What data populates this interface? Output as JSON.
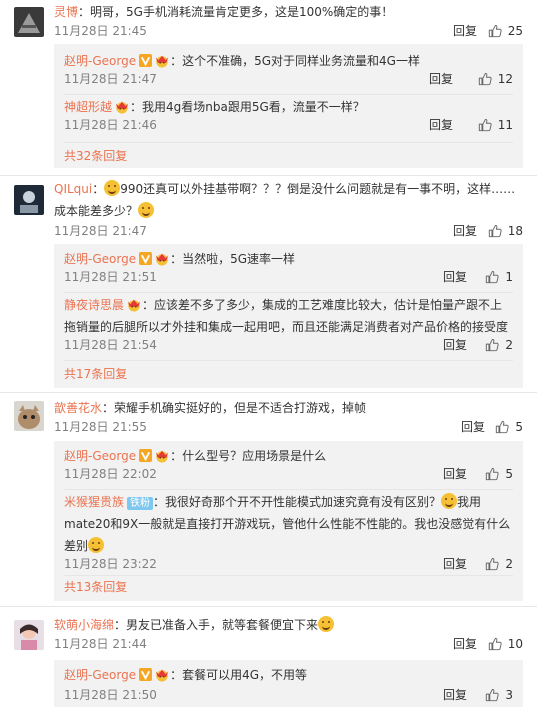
{
  "comments": [
    {
      "name": "灵博",
      "text": "：明哥，5G手机消耗流量肯定更多，这是100%确定的事！",
      "time": "11月28日 21:45",
      "reply_label": "回复",
      "likes": "25",
      "replies": [
        {
          "name": "赵明-George",
          "text": "：这个不准确，5G对于同样业务流量和4G一样",
          "time": "11月28日 21:47",
          "reply_label": "回复",
          "likes": "12"
        },
        {
          "name": "神超形越",
          "text": "：我用4g看场nba跟用5G看，流量不一样？",
          "time": "11月28日 21:46",
          "reply_label": "回复",
          "likes": "11"
        }
      ],
      "more": "共32条回复"
    },
    {
      "name": "QILqui",
      "text_a": "：",
      "text_b": "990还真可以外挂基带啊？？？倒是没什么问题就是有一事不明，这样……成本能差多少？",
      "time": "11月28日 21:47",
      "reply_label": "回复",
      "likes": "18",
      "replies": [
        {
          "name": "赵明-George",
          "text": "：当然啦，5G速率一样",
          "time": "11月28日 21:51",
          "reply_label": "回复",
          "likes": "1"
        },
        {
          "name": "静夜诗思晨",
          "text": "：应该差不多了多少，集成的工艺难度比较大，估计是怕量产跟不上拖销量的后腿所以才外挂和集成一起用吧，而且还能满足消费者对产品价格的接受度",
          "time": "11月28日 21:54",
          "reply_label": "回复",
          "likes": "2"
        }
      ],
      "more": "共17条回复"
    },
    {
      "name": "歆善花水",
      "text": "：荣耀手机确实挺好的，但是不适合打游戏，掉帧",
      "time": "11月28日 21:55",
      "reply_label": "回复",
      "likes": "5",
      "replies": [
        {
          "name": "赵明-George",
          "text": "：什么型号？应用场景是什么",
          "time": "11月28日 22:02",
          "reply_label": "回复",
          "likes": "5"
        },
        {
          "name": "米猴猩贵族",
          "tag": "铁粉",
          "text_a": "：我很好奇那个开不开性能模式加速究竟有没有区别？",
          "text_b": "我用mate20和9X一般就是直接打开游戏玩，管他什么性能不性能的。我也没感觉有什么差别",
          "time": "11月28日 23:22",
          "reply_label": "回复",
          "likes": "2"
        }
      ],
      "more": "共13条回复"
    },
    {
      "name": "软萌小海绵",
      "text": "：男友已准备入手，就等套餐便宜下来",
      "time": "11月28日 21:44",
      "reply_label": "回复",
      "likes": "10",
      "replies": [
        {
          "name": "赵明-George",
          "text": "：套餐可以用4G，不用等",
          "time": "11月28日 21:50",
          "reply_label": "回复",
          "likes": "3"
        }
      ]
    }
  ],
  "colors": {
    "name": "#eb7350",
    "meta": "#808080",
    "reply_bg": "#f2f2f2",
    "verified": "#f5a623"
  }
}
